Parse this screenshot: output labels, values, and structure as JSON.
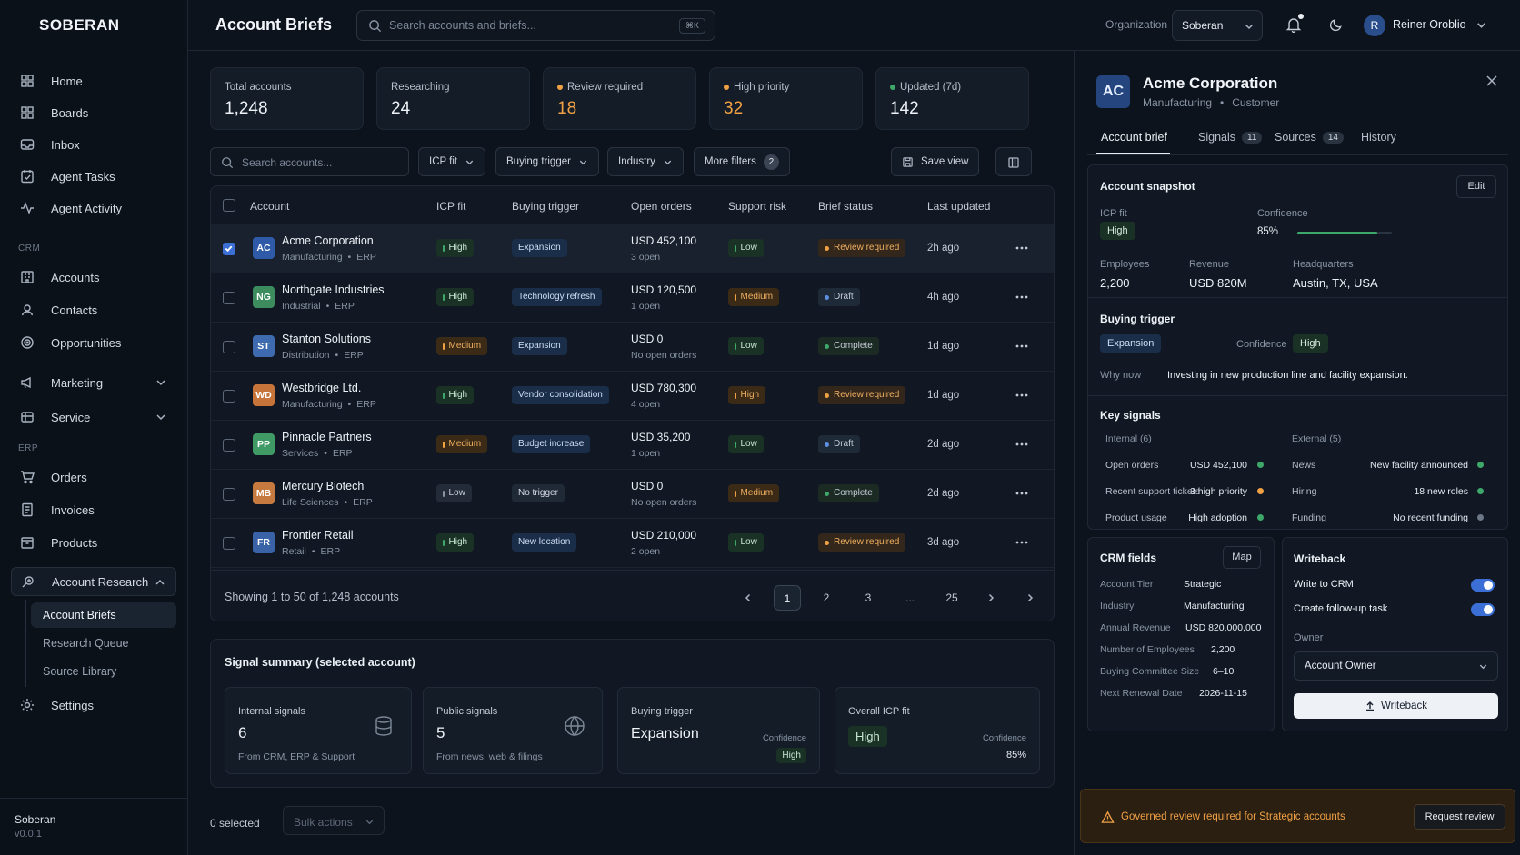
{
  "sidebar": {
    "logo": "SOBERAN",
    "items": [
      {
        "label": "Home",
        "icon": "home-icon"
      },
      {
        "label": "Boards",
        "icon": "boards-icon"
      },
      {
        "label": "Inbox",
        "icon": "inbox-icon"
      },
      {
        "label": "Agent Tasks",
        "icon": "tasks-icon"
      },
      {
        "label": "Agent Activity",
        "icon": "activity-icon"
      }
    ],
    "crm_label": "CRM",
    "crm_items": [
      {
        "label": "Accounts"
      },
      {
        "label": "Contacts"
      },
      {
        "label": "Opportunities"
      }
    ],
    "marketing": "Marketing",
    "service": "Service",
    "erp_label": "ERP",
    "erp_items": [
      {
        "label": "Orders"
      },
      {
        "label": "Invoices"
      },
      {
        "label": "Products"
      }
    ],
    "account_research": "Account Research",
    "sub_items": [
      "Account Briefs",
      "Research Queue",
      "Source Library"
    ],
    "settings": "Settings",
    "footer_org": "Soberan",
    "footer_version": "v0.0.1"
  },
  "header": {
    "title": "Account Briefs",
    "search_placeholder": "Search accounts and briefs...",
    "shortcut": "⌘K",
    "org_label": "Organization",
    "org_value": "Soberan",
    "user_initial": "R",
    "user_name": "Reiner Oroblio"
  },
  "stats": [
    {
      "label": "Total accounts",
      "value": "1,248",
      "dot": ""
    },
    {
      "label": "Researching",
      "value": "24",
      "dot": ""
    },
    {
      "label": "Review required",
      "value": "18",
      "dot": "#f0a144"
    },
    {
      "label": "High priority",
      "value": "32",
      "dot": "#f0a144"
    },
    {
      "label": "Updated (7d)",
      "value": "142",
      "dot": "#3ea86a"
    }
  ],
  "filters": {
    "search_placeholder": "Search accounts...",
    "icp_fit": "ICP fit",
    "buying_trigger": "Buying trigger",
    "industry": "Industry",
    "more_filters": "More filters",
    "more_count": "2",
    "save_view": "Save view"
  },
  "table": {
    "headers": [
      "Account",
      "ICP fit",
      "Buying trigger",
      "Open orders",
      "Support risk",
      "Brief status",
      "Last updated"
    ],
    "rows": [
      {
        "initials": "AC",
        "color": "#2e5aa8",
        "name": "Acme Corporation",
        "industry": "Manufacturing",
        "system": "ERP",
        "icp": "High",
        "trigger": "Expansion",
        "orders": "USD 452,100",
        "orders_sub": "3 open",
        "risk": "Low",
        "status": "Review required",
        "updated": "2h ago"
      },
      {
        "initials": "NG",
        "color": "#3c8c5e",
        "name": "Northgate Industries",
        "industry": "Industrial",
        "system": "ERP",
        "icp": "High",
        "trigger": "Technology refresh",
        "orders": "USD 120,500",
        "orders_sub": "1 open",
        "risk": "Medium",
        "status": "Draft",
        "updated": "4h ago"
      },
      {
        "initials": "ST",
        "color": "#3e6bb0",
        "name": "Stanton Solutions",
        "industry": "Distribution",
        "system": "ERP",
        "icp": "Medium",
        "trigger": "Expansion",
        "orders": "USD 0",
        "orders_sub": "No open orders",
        "risk": "Low",
        "status": "Complete",
        "updated": "1d ago"
      },
      {
        "initials": "WD",
        "color": "#c7743a",
        "name": "Westbridge Ltd.",
        "industry": "Manufacturing",
        "system": "ERP",
        "icp": "High",
        "trigger": "Vendor consolidation",
        "orders": "USD 780,300",
        "orders_sub": "4 open",
        "risk": "High",
        "status": "Review required",
        "updated": "1d ago"
      },
      {
        "initials": "PP",
        "color": "#3f9a66",
        "name": "Pinnacle Partners",
        "industry": "Services",
        "system": "ERP",
        "icp": "Medium",
        "trigger": "Budget increase",
        "orders": "USD 35,200",
        "orders_sub": "1 open",
        "risk": "Low",
        "status": "Draft",
        "updated": "2d ago"
      },
      {
        "initials": "MB",
        "color": "#c77a40",
        "name": "Mercury Biotech",
        "industry": "Life Sciences",
        "system": "ERP",
        "icp": "Low",
        "trigger": "No trigger",
        "orders": "USD 0",
        "orders_sub": "No open orders",
        "risk": "Medium",
        "status": "Complete",
        "updated": "2d ago"
      },
      {
        "initials": "FR",
        "color": "#3a62a6",
        "name": "Frontier Retail",
        "industry": "Retail",
        "system": "ERP",
        "icp": "High",
        "trigger": "New location",
        "orders": "USD 210,000",
        "orders_sub": "2 open",
        "risk": "Low",
        "status": "Review required",
        "updated": "3d ago"
      }
    ],
    "showing": "Showing 1 to 50 of 1,248 accounts",
    "pages": [
      "1",
      "2",
      "3",
      "...",
      "25"
    ]
  },
  "signal_summary": {
    "title": "Signal summary (selected account)",
    "internal_label": "Internal signals",
    "internal_value": "6",
    "internal_sub": "From CRM, ERP & Support",
    "public_label": "Public signals",
    "public_value": "5",
    "public_sub": "From news, web & filings",
    "trigger_label": "Buying trigger",
    "trigger_value": "Expansion",
    "trigger_conf_label": "Confidence",
    "trigger_conf": "High",
    "icp_label": "Overall ICP fit",
    "icp_value": "High",
    "icp_conf_label": "Confidence",
    "icp_conf": "85%"
  },
  "bottom": {
    "selected": "0 selected",
    "bulk": "Bulk actions"
  },
  "panel": {
    "initials": "AC",
    "name": "Acme Corporation",
    "industry": "Manufacturing",
    "type": "Customer",
    "tabs": [
      {
        "label": "Account brief",
        "count": ""
      },
      {
        "label": "Signals",
        "count": "11"
      },
      {
        "label": "Sources",
        "count": "14"
      },
      {
        "label": "History",
        "count": ""
      }
    ],
    "snapshot": {
      "title": "Account snapshot",
      "edit": "Edit",
      "icp_label": "ICP fit",
      "icp_value": "High",
      "confidence_label": "Confidence",
      "confidence_value": "85%",
      "confidence_fraction": 0.85,
      "employees_label": "Employees",
      "employees": "2,200",
      "revenue_label": "Revenue",
      "revenue": "USD 820M",
      "hq_label": "Headquarters",
      "hq": "Austin, TX, USA"
    },
    "trigger": {
      "title": "Buying trigger",
      "value": "Expansion",
      "confidence_label": "Confidence",
      "confidence": "High",
      "why_label": "Why now",
      "why": "Investing in new production line and facility expansion."
    },
    "signals": {
      "title": "Key signals",
      "internal_label": "Internal (6)",
      "external_label": "External (5)",
      "internal": [
        {
          "label": "Open orders",
          "value": "USD 452,100",
          "color": "#3ea86a"
        },
        {
          "label": "Recent support tickets",
          "value": "3 high priority",
          "color": "#f0a144"
        },
        {
          "label": "Product usage",
          "value": "High adoption",
          "color": "#3ea86a"
        }
      ],
      "external": [
        {
          "label": "News",
          "value": "New facility announced",
          "color": "#3ea86a"
        },
        {
          "label": "Hiring",
          "value": "18 new roles",
          "color": "#3ea86a"
        },
        {
          "label": "Funding",
          "value": "No recent funding",
          "color": "#6c7787"
        }
      ]
    },
    "crm": {
      "title": "CRM fields",
      "map": "Map",
      "fields": [
        {
          "label": "Account Tier",
          "value": "Strategic"
        },
        {
          "label": "Industry",
          "value": "Manufacturing"
        },
        {
          "label": "Annual Revenue",
          "value": "USD 820,000,000"
        },
        {
          "label": "Number of Employees",
          "value": "2,200"
        },
        {
          "label": "Buying Committee Size",
          "value": "6–10"
        },
        {
          "label": "Next Renewal Date",
          "value": "2026-11-15"
        }
      ]
    },
    "writeback": {
      "title": "Writeback",
      "write_crm": "Write to CRM",
      "follow_up": "Create follow-up task",
      "owner_label": "Owner",
      "owner": "Account Owner",
      "button": "Writeback"
    },
    "warning": {
      "text": "Governed review required for Strategic accounts",
      "button": "Request review"
    }
  }
}
